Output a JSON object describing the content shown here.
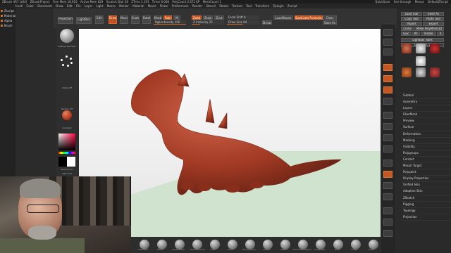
{
  "app": {
    "title_items": [
      "ZBrush 4R7 [x64]",
      "ZBrushProject",
      "Free Mem 18.616",
      "Active Mem 829",
      "Scratch Disk 58",
      "ZTime 1.193",
      "Timer 0.008",
      "PolyCount 2.672 KP",
      "MeshCount 1"
    ],
    "top_right_items": [
      "QuickSave",
      "See-through",
      "Menus",
      "DefaultZScript"
    ],
    "menus": [
      "Alpha",
      "Brush",
      "Color",
      "Document",
      "Draw",
      "Edit",
      "File",
      "Layer",
      "Light",
      "Macro",
      "Marker",
      "Material",
      "Movie",
      "Picker",
      "Preferences",
      "Render",
      "Stencil",
      "Stroke",
      "Texture",
      "Tool",
      "Transform",
      "Zplugin",
      "Zscript"
    ]
  },
  "left_panel": {
    "items": [
      "Zscript",
      "Material",
      "Alpha",
      "Brush"
    ]
  },
  "toolbar": {
    "projection_master": "Projection Master",
    "lightbox": "LightBox",
    "edit": "Edit",
    "draw": "Draw",
    "move": "Move",
    "scale": "Scale",
    "rotate": "Rotate",
    "mrgb": "Mrgb",
    "rgb": "Rgb",
    "m": "M",
    "zadd": "Zadd",
    "zsub": "Zsub",
    "zcut": "Zcut",
    "rgb_intensity_label": "Rgb Intensity",
    "rgb_intensity_value": "100",
    "z_intensity_label": "Z Intensity",
    "z_intensity_value": "25",
    "focal_shift_label": "Focal Shift",
    "focal_shift_value": "0",
    "draw_size_label": "Draw Size",
    "draw_size_value": "64",
    "dynamic": "Dynamic",
    "lazy_mouse": "LazyMouse",
    "spotlight": "SpotLight Projection",
    "clear": "Clear",
    "save_as": "Save As"
  },
  "left_tray": {
    "material_label": "MatCap Red Wax",
    "alpha_label": "Alpha Off",
    "texture_label": "Texture Off",
    "gradient_label": "Gradient",
    "switch_label": "SwitchColor",
    "alternate_label": "Alternate"
  },
  "right_panel": {
    "buttons_row1": [
      "Load Tool",
      "Save As"
    ],
    "buttons_row2": [
      "Copy Tool",
      "Paste Tool"
    ],
    "buttons_row3": [
      "Import",
      "Export"
    ],
    "buttons_row4": [
      "Clone",
      "Make PolyMesh3D"
    ],
    "buttons_row5": [
      "GoZ",
      "All",
      "Visible",
      "R"
    ],
    "lightbox_tools": "Lightbox Tools",
    "tool_name": "Dinosaur_5",
    "list": [
      "Subtool",
      "Geometry",
      "Layers",
      "FiberMesh",
      "Preview",
      "Surface",
      "Deformation",
      "Masking",
      "Visibility",
      "Polygroups",
      "Contact",
      "Morph Target",
      "Polypaint",
      "Display Properties",
      "Unified Skin",
      "Adaptive Skin",
      "ZSketch",
      "Rigging",
      "Topology",
      "Projection"
    ]
  },
  "bottom_bar": {
    "items": [
      "Standard",
      "Move",
      "ClayBuildup",
      "DamStandard",
      "Inflat",
      "Pinch",
      "TrimDynamic",
      "hPolish",
      "Slash3",
      "Move Topological",
      "ClayTubes",
      "Dots",
      "Snake",
      "Knife"
    ]
  },
  "colors": {
    "accent": "#d4692c",
    "panel": "#2b2b2b",
    "model": "#b5432a"
  }
}
